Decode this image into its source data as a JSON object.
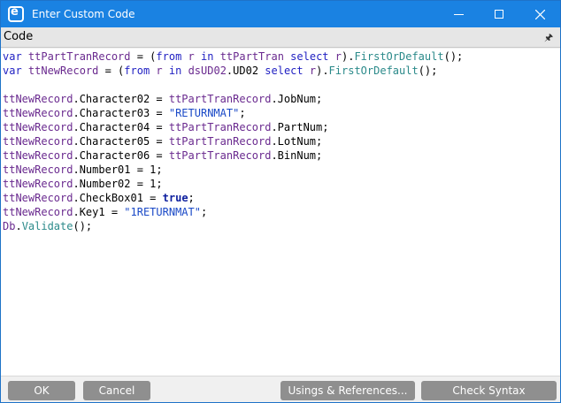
{
  "window": {
    "title": "Enter Custom Code",
    "app_icon": "epicor-e-icon",
    "controls": [
      "minimize-icon",
      "maximize-icon",
      "close-icon"
    ]
  },
  "panel": {
    "title": "Code",
    "pin_icon": "pin-icon"
  },
  "code": {
    "lines": [
      "var ttPartTranRecord = (from r in ttPartTran select r).FirstOrDefault();",
      "var ttNewRecord = (from r in dsUD02.UD02 select r).FirstOrDefault();",
      "",
      "ttNewRecord.Character02 = ttPartTranRecord.JobNum;",
      "ttNewRecord.Character03 = \"RETURNMAT\";",
      "ttNewRecord.Character04 = ttPartTranRecord.PartNum;",
      "ttNewRecord.Character05 = ttPartTranRecord.LotNum;",
      "ttNewRecord.Character06 = ttPartTranRecord.BinNum;",
      "ttNewRecord.Number01 = 1;",
      "ttNewRecord.Number02 = 1;",
      "ttNewRecord.CheckBox01 = true;",
      "ttNewRecord.Key1 = \"1RETURNMAT\";",
      "Db.Validate();"
    ]
  },
  "buttons": {
    "ok": "OK",
    "cancel": "Cancel",
    "usings": "Usings & References...",
    "check_syntax": "Check Syntax"
  },
  "colors": {
    "titlebar": "#1a82e2",
    "keyword": "#1f1fc2",
    "type": "#6a2a8f",
    "string": "#1a49c7",
    "method": "#2b8a8a",
    "button": "#8f8f8f"
  }
}
